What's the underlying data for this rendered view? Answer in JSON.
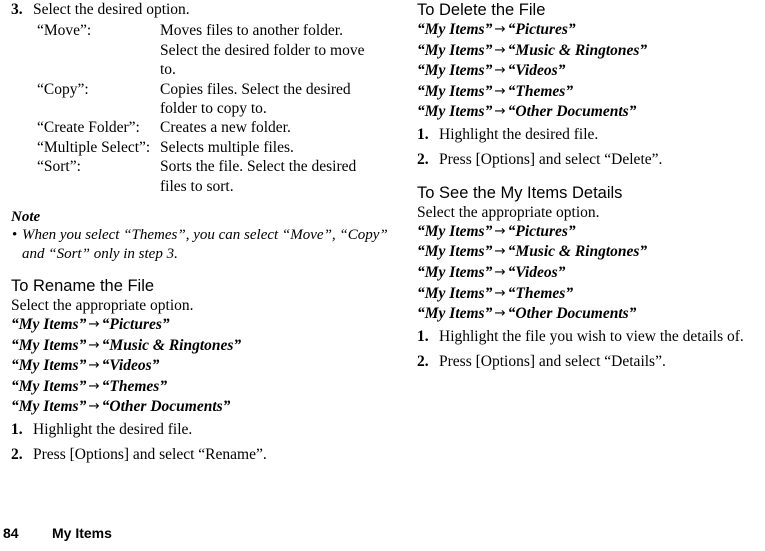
{
  "page": {
    "number": "84",
    "section": "My Items"
  },
  "left_column": {
    "step3": {
      "num": "3.",
      "text": "Select the desired option."
    },
    "options_table": {
      "rows": [
        {
          "term": "“Move”:",
          "desc": "Moves files to another folder. Select the desired folder to move to."
        },
        {
          "term": "“Copy”:",
          "desc": "Copies files. Select the desired folder to copy to."
        },
        {
          "term": "“Create Folder”:",
          "desc": "Creates a new folder."
        },
        {
          "term": "“Multiple Select”:",
          "desc": "Selects multiple files."
        },
        {
          "term": "“Sort”:",
          "desc": "Sorts the file. Select the desired files to sort."
        }
      ]
    },
    "note": {
      "title": "Note",
      "bullet": "•",
      "text": "When you select “Themes”, you can select “Move”, “Copy” and “Sort” only in step 3."
    },
    "rename_section": {
      "heading": "To Rename the File",
      "lead": "Select the appropriate option.",
      "paths": [
        {
          "root": "“My Items”",
          "arrow": "→",
          "target": "“Pictures”"
        },
        {
          "root": "“My Items”",
          "arrow": "→",
          "target": "“Music & Ringtones”"
        },
        {
          "root": "“My Items”",
          "arrow": "→",
          "target": "“Videos”"
        },
        {
          "root": "“My Items”",
          "arrow": "→",
          "target": "“Themes”"
        },
        {
          "root": "“My Items”",
          "arrow": "→",
          "target": "“Other Documents”"
        }
      ],
      "steps": [
        {
          "num": "1.",
          "text": "Highlight the desired file."
        },
        {
          "num": "2.",
          "text": "Press [Options] and select “Rename”."
        }
      ]
    }
  },
  "right_column": {
    "delete_section": {
      "heading": "To Delete the File",
      "paths": [
        {
          "root": "“My Items”",
          "arrow": "→",
          "target": "“Pictures”"
        },
        {
          "root": "“My Items”",
          "arrow": "→",
          "target": "“Music & Ringtones”"
        },
        {
          "root": "“My Items”",
          "arrow": "→",
          "target": "“Videos”"
        },
        {
          "root": "“My Items”",
          "arrow": "→",
          "target": "“Themes”"
        },
        {
          "root": "“My Items”",
          "arrow": "→",
          "target": "“Other Documents”"
        }
      ],
      "steps": [
        {
          "num": "1.",
          "text": "Highlight the desired file."
        },
        {
          "num": "2.",
          "text": "Press [Options] and select “Delete”."
        }
      ]
    },
    "details_section": {
      "heading": "To See the My Items Details",
      "lead": "Select the appropriate option.",
      "paths": [
        {
          "root": "“My Items”",
          "arrow": "→",
          "target": "“Pictures”"
        },
        {
          "root": "“My Items”",
          "arrow": "→",
          "target": "“Music & Ringtones”"
        },
        {
          "root": "“My Items”",
          "arrow": "→",
          "target": "“Videos”"
        },
        {
          "root": "“My Items”",
          "arrow": "→",
          "target": "“Themes”"
        },
        {
          "root": "“My Items”",
          "arrow": "→",
          "target": "“Other Documents”"
        }
      ],
      "steps": [
        {
          "num": "1.",
          "text": "Highlight the file you wish to view the details of."
        },
        {
          "num": "2.",
          "text": "Press [Options] and select “Details”."
        }
      ]
    }
  }
}
